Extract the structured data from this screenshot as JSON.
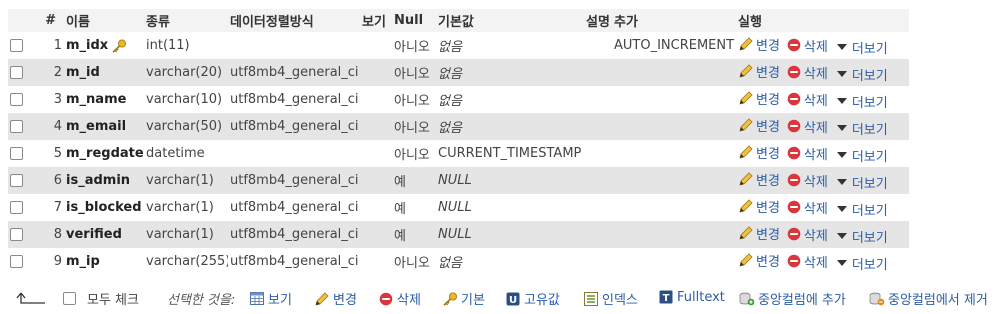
{
  "headers": {
    "hash": "#",
    "name": "이름",
    "type": "종류",
    "collation": "데이터정렬방식",
    "attributes": "보기",
    "null": "Null",
    "default": "기본값",
    "comments": "설명",
    "extra": "추가",
    "action": "실행"
  },
  "rows": [
    {
      "num": "1",
      "name": "m_idx",
      "type": "int(11)",
      "collation": "",
      "null": "아니오",
      "default": "없음",
      "extra": "AUTO_INCREMENT",
      "primary_key": true
    },
    {
      "num": "2",
      "name": "m_id",
      "type": "varchar(20)",
      "collation": "utf8mb4_general_ci",
      "null": "아니오",
      "default": "없음",
      "extra": ""
    },
    {
      "num": "3",
      "name": "m_name",
      "type": "varchar(10)",
      "collation": "utf8mb4_general_ci",
      "null": "아니오",
      "default": "없음",
      "extra": ""
    },
    {
      "num": "4",
      "name": "m_email",
      "type": "varchar(50)",
      "collation": "utf8mb4_general_ci",
      "null": "아니오",
      "default": "없음",
      "extra": ""
    },
    {
      "num": "5",
      "name": "m_regdate",
      "type": "datetime",
      "collation": "",
      "null": "아니오",
      "default": "CURRENT_TIMESTAMP",
      "extra": ""
    },
    {
      "num": "6",
      "name": "is_admin",
      "type": "varchar(1)",
      "collation": "utf8mb4_general_ci",
      "null": "예",
      "default": "NULL",
      "extra": ""
    },
    {
      "num": "7",
      "name": "is_blocked",
      "type": "varchar(1)",
      "collation": "utf8mb4_general_ci",
      "null": "예",
      "default": "NULL",
      "extra": ""
    },
    {
      "num": "8",
      "name": "verified",
      "type": "varchar(1)",
      "collation": "utf8mb4_general_ci",
      "null": "예",
      "default": "NULL",
      "extra": ""
    },
    {
      "num": "9",
      "name": "m_ip",
      "type": "varchar(255)",
      "collation": "utf8mb4_general_ci",
      "null": "아니오",
      "default": "없음",
      "extra": ""
    }
  ],
  "row_actions": {
    "edit": "변경",
    "drop": "삭제",
    "more": "더보기"
  },
  "footer": {
    "check_all": "모두 체크",
    "with_selected": "선택한 것을:",
    "browse": "보기",
    "change": "변경",
    "drop": "삭제",
    "primary": "기본",
    "unique": "고유값",
    "index": "인덱스",
    "fulltext": "Fulltext",
    "add_central": "중앙컬럼에 추가",
    "remove_central": "중앙컬럼에서 제거"
  },
  "colors": {
    "link": "#2b5ea8",
    "row_alt": "#e5e5e5",
    "header_bg": "#f3f3f3",
    "drop_red": "#d9363e"
  }
}
